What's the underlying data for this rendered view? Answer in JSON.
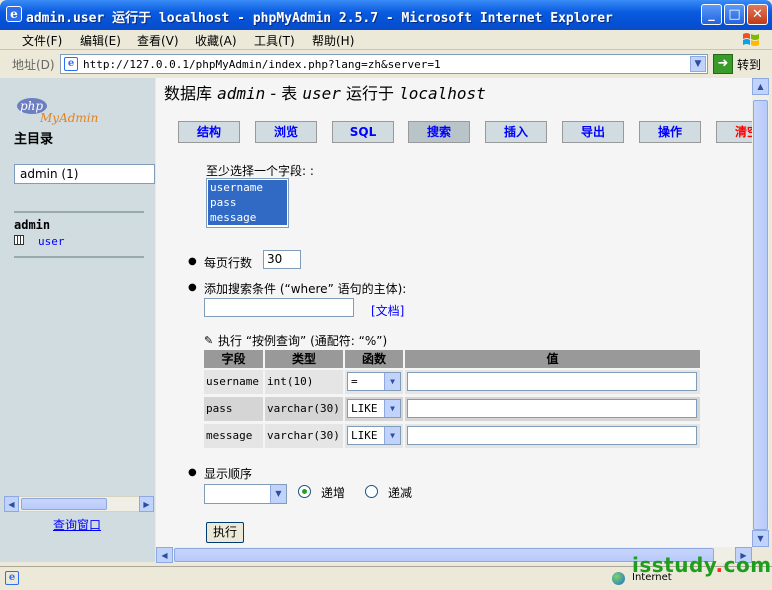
{
  "window": {
    "title": "admin.user 运行于 localhost - phpMyAdmin 2.5.7 - Microsoft Internet Explorer",
    "ie_icon": "e",
    "minimize": "_",
    "maximize": "□",
    "close": "✕"
  },
  "menu": [
    "文件(F)",
    "编辑(E)",
    "查看(V)",
    "收藏(A)",
    "工具(T)",
    "帮助(H)"
  ],
  "address": {
    "label": "地址(D)",
    "url": "http://127.0.0.1/phpMyAdmin/index.php?lang=zh&server=1",
    "go_label": "转到"
  },
  "left": {
    "logo_php": "php",
    "logo_myadmin": "MyAdmin",
    "home": "主目录",
    "db_select": "admin (1)",
    "db_name": "admin",
    "table": "user",
    "query_window": "查询窗口"
  },
  "main": {
    "title_db": "数据库",
    "title_db_name": "admin",
    "title_sep": " - 表 ",
    "title_table": "user",
    "title_on": "运行于",
    "title_host": "localhost",
    "tabs": [
      {
        "label": "结构"
      },
      {
        "label": "浏览"
      },
      {
        "label": "SQL"
      },
      {
        "label": "搜索"
      },
      {
        "label": "插入"
      },
      {
        "label": "导出"
      },
      {
        "label": "操作"
      },
      {
        "label": "清空"
      }
    ],
    "field_select_label": "至少选择一个字段: :",
    "fields": [
      "username",
      "pass",
      "message"
    ],
    "rows_label": "每页行数",
    "rows_value": "30",
    "where_label": "添加搜索条件 (“where” 语句的主体):",
    "doc_link": "[文档]",
    "qbe_label": "执行 “按例查询” (通配符: “%”)",
    "table_headers": [
      "字段",
      "类型",
      "函数",
      "值"
    ],
    "rows": [
      {
        "name": "username",
        "type": "int(10)",
        "func": "="
      },
      {
        "name": "pass",
        "type": "varchar(30)",
        "func": "LIKE"
      },
      {
        "name": "message",
        "type": "varchar(30)",
        "func": "LIKE"
      }
    ],
    "order_label": "显示顺序",
    "asc_label": "递增",
    "desc_label": "递减",
    "execute": "执行"
  },
  "status": {
    "zone": "Internet"
  },
  "watermark": {
    "main": "isstudy",
    "dot": ".",
    "tld": "com"
  }
}
